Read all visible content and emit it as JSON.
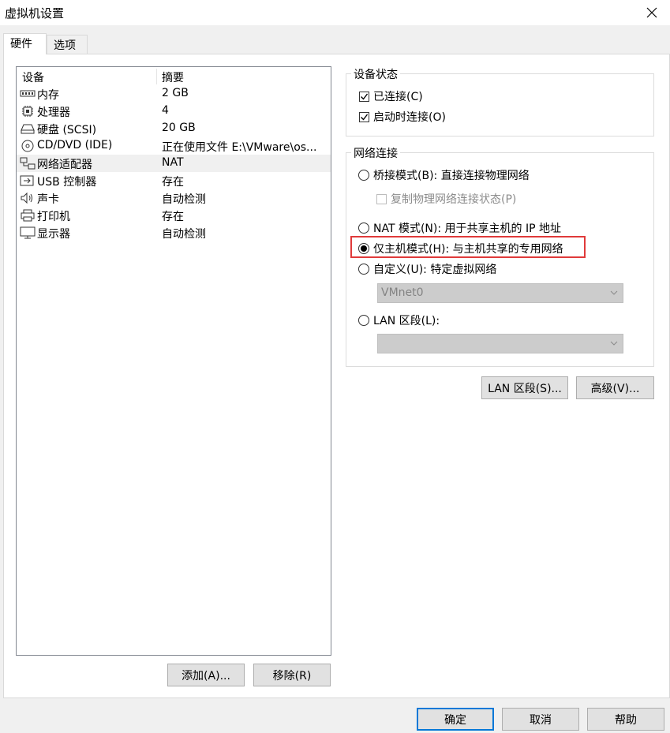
{
  "window": {
    "title": "虚拟机设置"
  },
  "tabs": [
    {
      "label": "硬件"
    },
    {
      "label": "选项"
    }
  ],
  "device_list": {
    "columns": {
      "device": "设备",
      "summary": "摘要"
    },
    "rows": [
      {
        "name": "内存",
        "summary": "2 GB",
        "icon": "memory-icon"
      },
      {
        "name": "处理器",
        "summary": "4",
        "icon": "cpu-icon"
      },
      {
        "name": "硬盘 (SCSI)",
        "summary": "20 GB",
        "icon": "harddisk-icon"
      },
      {
        "name": "CD/DVD (IDE)",
        "summary": "正在使用文件 E:\\VMware\\os...",
        "icon": "cd-dvd-icon"
      },
      {
        "name": "网络适配器",
        "summary": "NAT",
        "icon": "network-adapter-icon",
        "selected": true
      },
      {
        "name": "USB 控制器",
        "summary": "存在",
        "icon": "usb-icon"
      },
      {
        "name": "声卡",
        "summary": "自动检测",
        "icon": "sound-card-icon"
      },
      {
        "name": "打印机",
        "summary": "存在",
        "icon": "printer-icon"
      },
      {
        "name": "显示器",
        "summary": "自动检测",
        "icon": "display-icon"
      }
    ],
    "add_label": "添加(A)...",
    "remove_label": "移除(R)"
  },
  "device_status": {
    "title": "设备状态",
    "connected": {
      "label": "已连接(C)",
      "checked": true
    },
    "connect_on_power": {
      "label": "启动时连接(O)",
      "checked": true
    }
  },
  "network": {
    "title": "网络连接",
    "bridged": {
      "label": "桥接模式(B): 直接连接物理网络",
      "selected": false
    },
    "replicate": {
      "label": "复制物理网络连接状态(P)",
      "checked": false,
      "enabled": false
    },
    "nat": {
      "label": "NAT 模式(N): 用于共享主机的 IP 地址",
      "selected": false
    },
    "hostonly": {
      "label": "仅主机模式(H): 与主机共享的专用网络",
      "selected": true
    },
    "custom": {
      "label": "自定义(U): 特定虚拟网络",
      "selected": false
    },
    "custom_select": "VMnet0",
    "lan": {
      "label": "LAN 区段(L):",
      "selected": false
    },
    "lan_select": ""
  },
  "advanced_buttons": {
    "lan_segments": "LAN 区段(S)...",
    "advanced": "高级(V)..."
  },
  "footer": {
    "ok": "确定",
    "cancel": "取消",
    "help": "帮助"
  },
  "colors": {
    "highlight": "#e03a3a",
    "default_button_border": "#0078d7",
    "selected_row": "#f0f0f0"
  }
}
